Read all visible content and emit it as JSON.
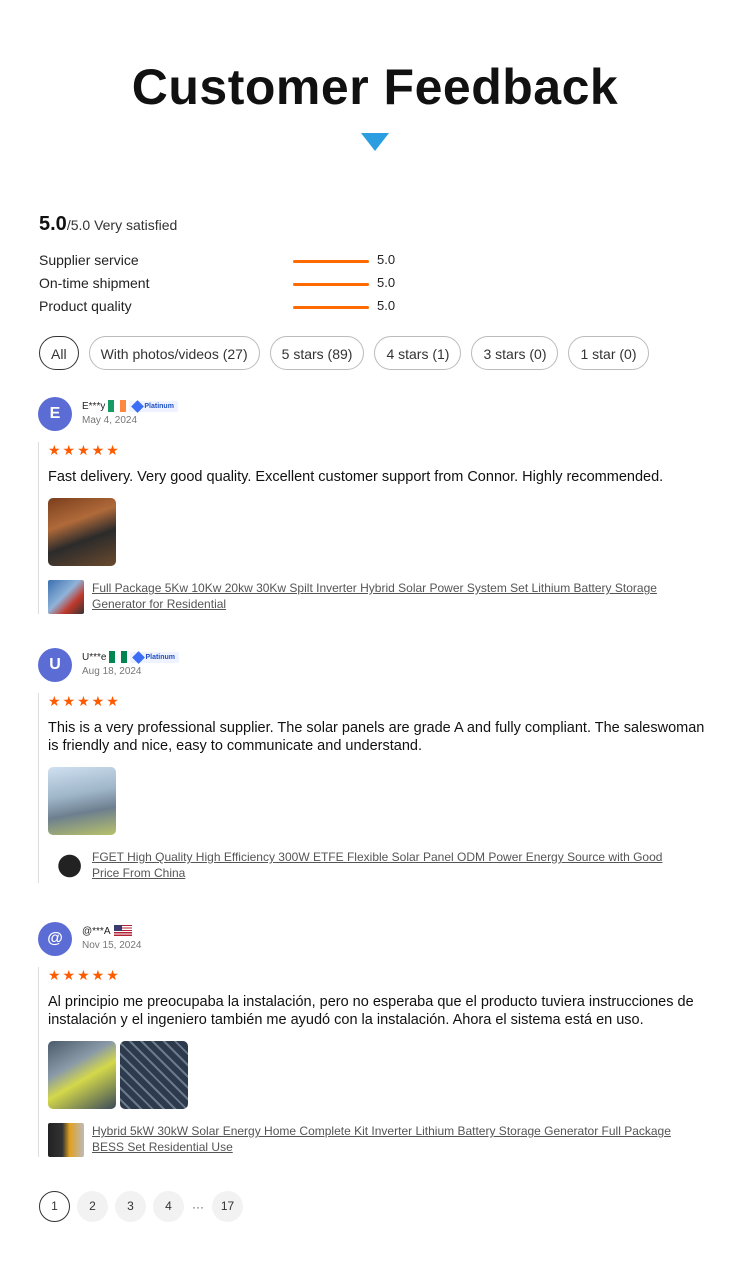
{
  "heading": "Customer Feedback",
  "summary": {
    "score": "5.0",
    "out_of": "/5.0",
    "verdict": "Very satisfied"
  },
  "metrics": [
    {
      "label": "Supplier service",
      "value": "5.0",
      "fill": 1.0
    },
    {
      "label": "On-time shipment",
      "value": "5.0",
      "fill": 1.0
    },
    {
      "label": "Product quality",
      "value": "5.0",
      "fill": 1.0
    }
  ],
  "filters": [
    "All",
    "With photos/videos (27)",
    "5 stars (89)",
    "4 stars (1)",
    "3 stars (0)",
    "1 star (0)"
  ],
  "badge_label": "Platinum",
  "reviews": [
    {
      "initial": "E",
      "user": "E***y",
      "flag": "Ireland",
      "platinum": true,
      "date": "May 4, 2024",
      "stars": "★★★★★",
      "text": "Fast delivery. Very good quality. Excellent customer support from Connor. Highly recommended.",
      "photo_count": 1,
      "product": "Full Package 5Kw 10Kw 20kw 30Kw Spilt Inverter Hybrid Solar Power System Set Lithium Battery Storage Generator for Residential"
    },
    {
      "initial": "U",
      "user": "U***e",
      "flag": "Nigeria",
      "platinum": true,
      "date": "Aug 18, 2024",
      "stars": "★★★★★",
      "text": "This is a very professional supplier. The solar panels are grade A and fully compliant. The saleswoman is friendly and nice, easy to communicate and understand.",
      "photo_count": 1,
      "product": "FGET High Quality High Efficiency 300W ETFE Flexible Solar Panel ODM Power Energy Source with Good Price From China"
    },
    {
      "initial": "@",
      "user": "@***A",
      "flag": "United States",
      "platinum": false,
      "date": "Nov 15, 2024",
      "stars": "★★★★★",
      "text": "Al principio me preocupaba la instalación, pero no esperaba que el producto tuviera instrucciones de instalación y el ingeniero también me ayudó con la instalación. Ahora el sistema está en uso.",
      "photo_count": 2,
      "product": "Hybrid 5kW 30kW Solar Energy Home Complete Kit Inverter Lithium Battery Storage Generator Full Package BESS Set Residential Use"
    }
  ],
  "pagination": {
    "pages": [
      "1",
      "2",
      "3",
      "4"
    ],
    "ellipsis": "···",
    "last": "17",
    "current": "1"
  },
  "colors": {
    "accent": "#ff6a00",
    "avatar": "#5b6cd4",
    "arrow": "#2a9ee0"
  }
}
